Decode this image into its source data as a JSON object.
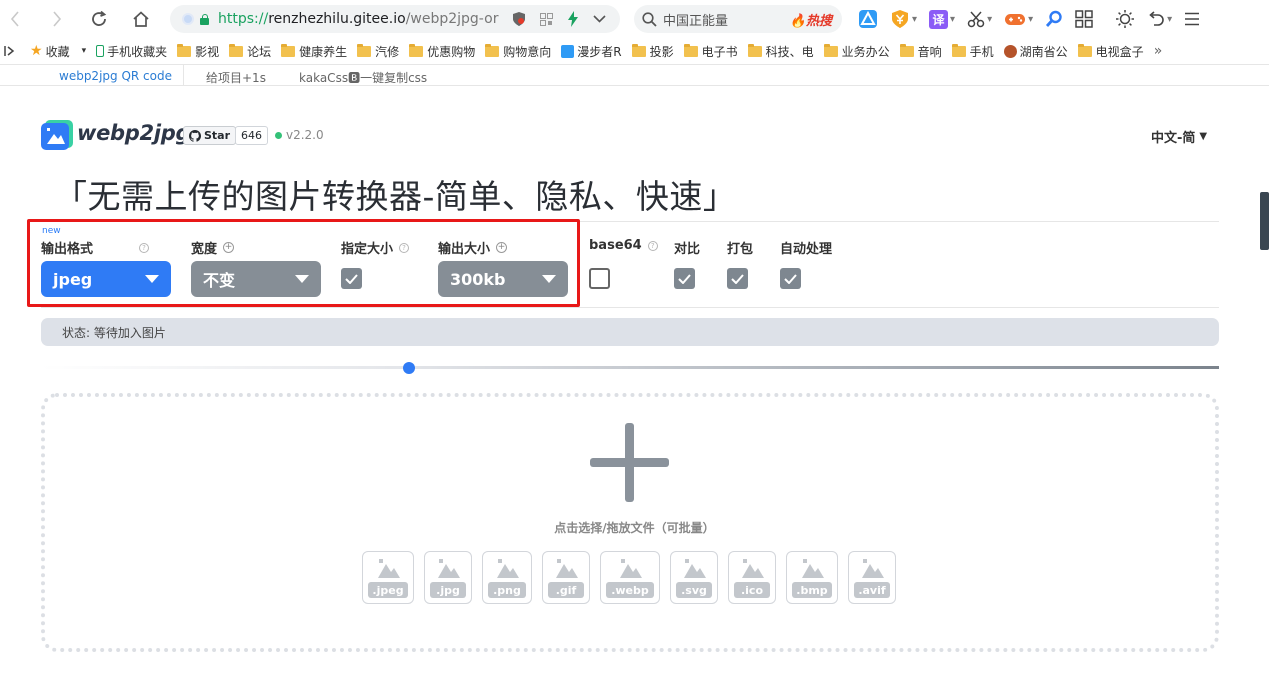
{
  "browser": {
    "url_protocol": "https://",
    "url_host": "renzhezhilu.gitee.io",
    "url_path": "/webp2jpg-or",
    "search_placeholder": "中国正能量",
    "search_hot_tag": "热搜",
    "translate_ext_label": "译"
  },
  "bookmarks": {
    "favorites_label": "收藏",
    "items": [
      "手机收藏夹",
      "影视",
      "论坛",
      "健康养生",
      "汽修",
      "优惠购物",
      "购物意向",
      "漫步者R",
      "投影",
      "电子书",
      "科技、电",
      "业务办公",
      "音响",
      "手机",
      "湖南省公",
      "电视盒子"
    ],
    "more_label": "»"
  },
  "tabs": [
    {
      "label": "webp2jpg QR code"
    },
    {
      "label": "给项目+1s"
    },
    {
      "label": "kakaCss🅱一键复制css"
    }
  ],
  "app": {
    "logo_text": "webp2jpg",
    "star_label": "Star",
    "star_count": "646",
    "version": "v2.2.0",
    "language": "中文-简",
    "headline": "「无需上传的图片转换器-简单、隐私、快速」"
  },
  "settings": {
    "new_tag": "new",
    "output_format": {
      "label": "输出格式",
      "value": "jpeg"
    },
    "width": {
      "label": "宽度",
      "value": "不变"
    },
    "specify_size": {
      "label": "指定大小",
      "checked": true
    },
    "output_size": {
      "label": "输出大小",
      "value": "300kb"
    },
    "base64": {
      "label": "base64",
      "checked": false
    },
    "compare": {
      "label": "对比",
      "checked": true
    },
    "pack": {
      "label": "打包",
      "checked": true
    },
    "auto_process": {
      "label": "自动处理",
      "checked": true
    }
  },
  "status": {
    "text": "状态: 等待加入图片"
  },
  "dropzone": {
    "hint": "点击选择/拖放文件（可批量）",
    "formats": [
      ".jpeg",
      ".jpg",
      ".png",
      ".gif",
      ".webp",
      ".svg",
      ".ico",
      ".bmp",
      ".avif"
    ]
  },
  "colors": {
    "accent": "#2f7bf5",
    "highlight_border": "#e81818",
    "control_gray": "#868e96"
  },
  "icons": {
    "back": "arrow-left-icon",
    "forward": "arrow-right-icon",
    "reload": "reload-icon",
    "home": "home-icon",
    "search": "search-icon",
    "caret": "caret-down-icon",
    "check": "checkmark-icon",
    "plus": "plus-icon",
    "image": "image-icon"
  }
}
